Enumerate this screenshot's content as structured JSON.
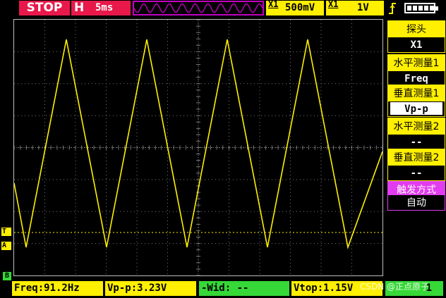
{
  "status": "STOP",
  "timebase": {
    "label": "H",
    "value": "5ms"
  },
  "ch1": {
    "label": "X1",
    "value": "500mV"
  },
  "ch2": {
    "label": "X1",
    "value": "1V"
  },
  "menu": [
    {
      "title": "探头",
      "value": "X1",
      "selected": false
    },
    {
      "title": "水平测量1",
      "value": "Freq",
      "selected": false
    },
    {
      "title": "垂直测量1",
      "value": "Vp-p",
      "selected": true
    },
    {
      "title": "水平测量2",
      "value": "--",
      "selected": false
    },
    {
      "title": "垂直测量2",
      "value": "--",
      "selected": false
    },
    {
      "title": "触发方式",
      "value": "自动",
      "selected": false
    }
  ],
  "markers": {
    "trigger": "T",
    "channel": "A",
    "bottom": "B"
  },
  "measurements": [
    {
      "text": "Freq:91.2Hz"
    },
    {
      "text": "Vp-p:3.23V"
    },
    {
      "text": "-Wid: --"
    },
    {
      "text": "Vtop:1.15V"
    },
    {
      "text": "1"
    }
  ],
  "watermark": "CSDN @正点原子",
  "colors": {
    "yellow": "#ffef00",
    "red": "#e8194a",
    "green": "#36d837",
    "magenta": "#e23cf0"
  }
}
